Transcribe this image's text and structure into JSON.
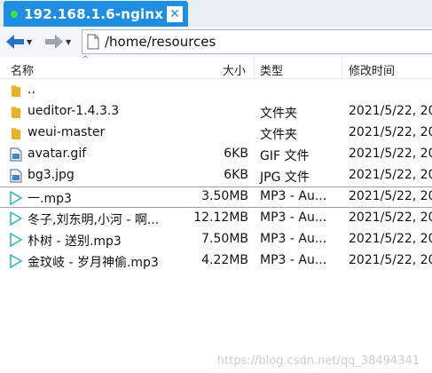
{
  "tab": {
    "title": "192.168.1.6-nginx",
    "close_glyph": "✕",
    "status_color": "#3be34a",
    "accent": "#1f8ee0"
  },
  "address": {
    "path": "/home/resources"
  },
  "columns": {
    "name": "名称",
    "size": "大小",
    "type": "类型",
    "modified": "修改时间"
  },
  "rows": [
    {
      "icon": "folder-icon",
      "name": "..",
      "size": "",
      "type": "",
      "date": ""
    },
    {
      "icon": "folder-icon",
      "name": "ueditor-1.4.3.3",
      "size": "",
      "type": "文件夹",
      "date": "2021/5/22, 20"
    },
    {
      "icon": "folder-icon",
      "name": "weui-master",
      "size": "",
      "type": "文件夹",
      "date": "2021/5/22, 20"
    },
    {
      "icon": "image-file-icon",
      "name": "avatar.gif",
      "size": "6KB",
      "type": "GIF 文件",
      "date": "2021/5/22, 20"
    },
    {
      "icon": "image-file-icon",
      "name": "bg3.jpg",
      "size": "6KB",
      "type": "JPG 文件",
      "date": "2021/5/22, 20"
    },
    {
      "icon": "mp3-file-icon",
      "name": "一.mp3",
      "size": "3.50MB",
      "type": "MP3 - Au...",
      "date": "2021/5/22, 20"
    },
    {
      "icon": "mp3-file-icon",
      "name": "冬子,刘东明,小河 - 啊...",
      "size": "12.12MB",
      "type": "MP3 - Au...",
      "date": "2021/5/22, 20"
    },
    {
      "icon": "mp3-file-icon",
      "name": "朴树 - 送别.mp3",
      "size": "7.50MB",
      "type": "MP3 - Au...",
      "date": "2021/5/22, 20"
    },
    {
      "icon": "mp3-file-icon",
      "name": "金玟岐 - 岁月神偷.mp3",
      "size": "4.22MB",
      "type": "MP3 - Au...",
      "date": "2021/5/22, 20"
    }
  ],
  "watermark": "https://blog.csdn.net/qq_38494341"
}
